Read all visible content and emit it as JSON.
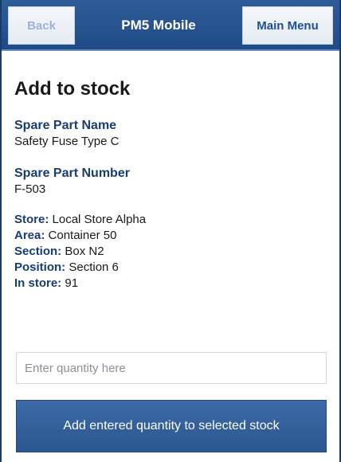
{
  "header": {
    "back_label": "Back",
    "app_title": "PM5 Mobile",
    "menu_label": "Main Menu"
  },
  "page": {
    "title": "Add to stock"
  },
  "part": {
    "name_label": "Spare Part Name",
    "name_value": "Safety Fuse Type C",
    "number_label": "Spare Part Number",
    "number_value": "F-503"
  },
  "details": [
    {
      "label": "Store:",
      "value": "Local Store Alpha"
    },
    {
      "label": "Area:",
      "value": "Container 50"
    },
    {
      "label": "Section:",
      "value": "Box N2"
    },
    {
      "label": "Position:",
      "value": "Section 6"
    },
    {
      "label": "In store:",
      "value": "91"
    }
  ],
  "quantity": {
    "placeholder": "Enter quantity here",
    "value": ""
  },
  "actions": {
    "submit_label": "Add entered quantity to selected stock"
  },
  "colors": {
    "header_bg": "#2a5690",
    "label_color": "#173d73",
    "button_bg": "#3a66a2"
  }
}
